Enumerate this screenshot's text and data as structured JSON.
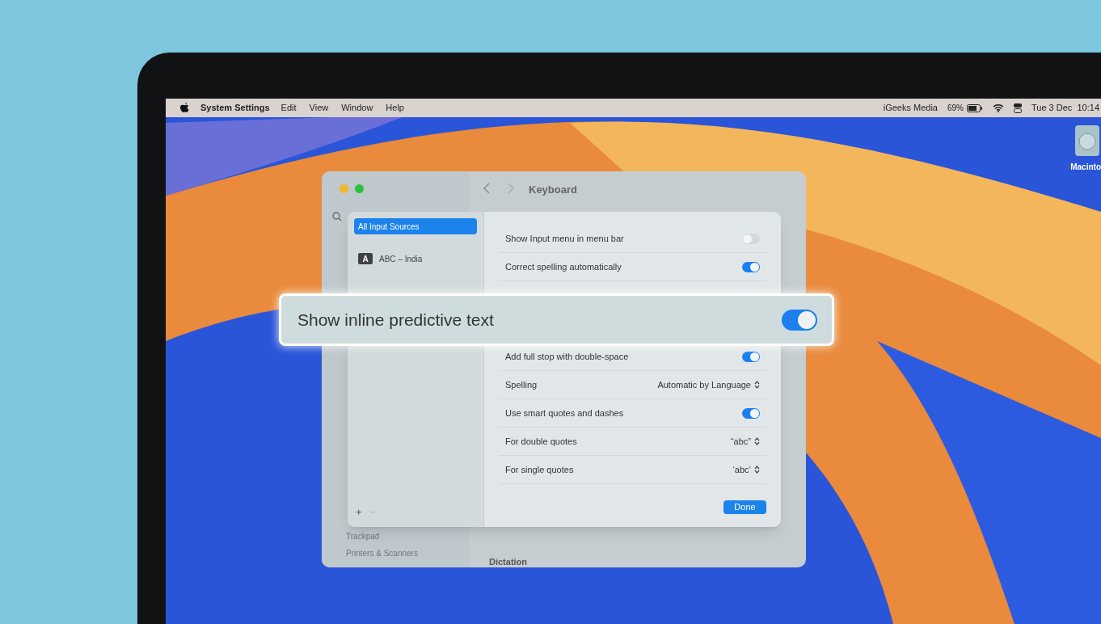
{
  "menu_bar": {
    "app": "System Settings",
    "menus": [
      "Edit",
      "View",
      "Window",
      "Help"
    ],
    "user": "iGeeks Media",
    "battery": "69%",
    "clock": "Tue 3 Dec  10:14"
  },
  "desktop_icons": [
    {
      "label": "Macinto"
    }
  ],
  "window": {
    "title": "Keyboard",
    "sidebar_items": [
      "Trackpad",
      "Printers & Scanners"
    ],
    "section": "Dictation"
  },
  "sheet": {
    "sources": [
      {
        "label": "All Input Sources",
        "selected": true
      },
      {
        "label": "ABC – India",
        "badge": "A",
        "selected": false
      }
    ],
    "rows": [
      {
        "kind": "toggle",
        "label": "Show Input menu in menu bar",
        "on": false
      },
      {
        "kind": "toggle",
        "label": "Correct spelling automatically",
        "on": true
      },
      {
        "kind": "toggle",
        "label": "Add full stop with double-space",
        "on": true
      },
      {
        "kind": "select",
        "label": "Spelling",
        "value": "Automatic by Language"
      },
      {
        "kind": "toggle",
        "label": "Use smart quotes and dashes",
        "on": true
      },
      {
        "kind": "select",
        "label": "For double quotes",
        "value": "“abc”"
      },
      {
        "kind": "select",
        "label": "For single quotes",
        "value": "‘abc’"
      }
    ],
    "footer_buttons": [
      "+",
      "−"
    ],
    "done_button": "Done"
  },
  "callout": {
    "label": "Show inline predictive text",
    "on": true
  }
}
